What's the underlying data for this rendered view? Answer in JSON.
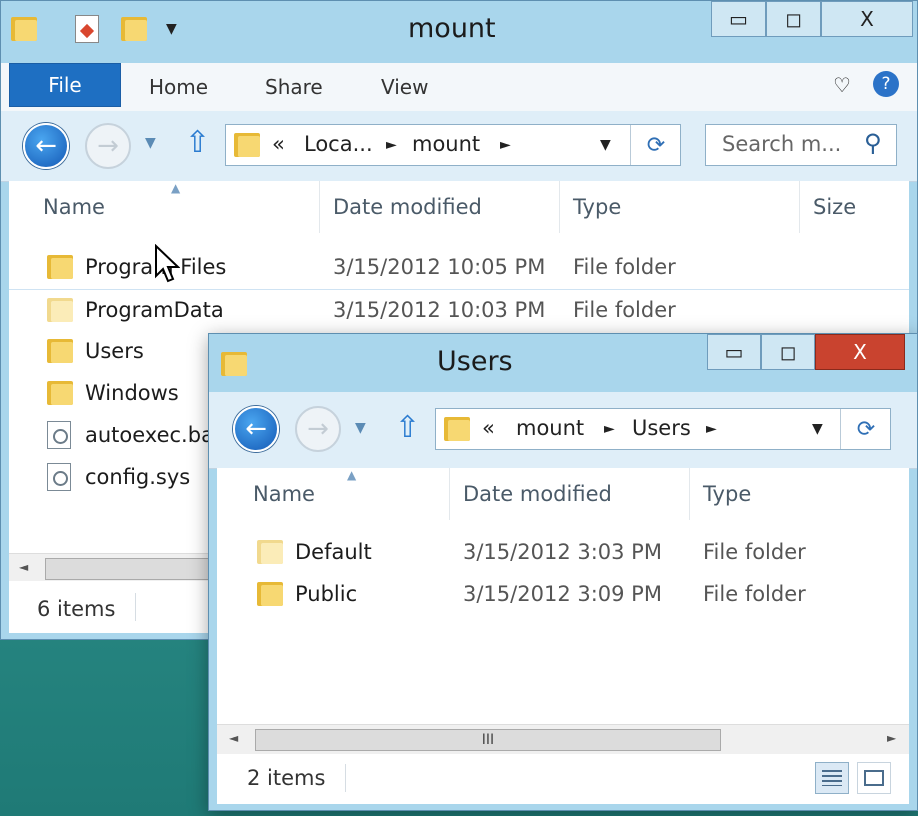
{
  "back_window": {
    "title": "mount",
    "ribbon": {
      "file": "File",
      "tabs": [
        "Home",
        "Share",
        "View"
      ]
    },
    "address": {
      "crumbs": [
        "«",
        "Loca...",
        "►",
        "mount",
        "►"
      ]
    },
    "search": {
      "placeholder": "Search m..."
    },
    "columns": [
      "Name",
      "Date modified",
      "Type",
      "Size"
    ],
    "rows": [
      {
        "name": "Program Files",
        "date": "3/15/2012 10:05 PM",
        "type": "File folder",
        "icon": "folder-icon"
      },
      {
        "name": "ProgramData",
        "date": "3/15/2012 10:03 PM",
        "type": "File folder",
        "icon": "folder-icon"
      },
      {
        "name": "Users",
        "date": "",
        "type": "",
        "icon": "folder-icon"
      },
      {
        "name": "Windows",
        "date": "",
        "type": "",
        "icon": "folder-icon"
      },
      {
        "name": "autoexec.ba",
        "date": "",
        "type": "",
        "icon": "system-file-icon"
      },
      {
        "name": "config.sys",
        "date": "",
        "type": "",
        "icon": "system-file-icon"
      }
    ],
    "status": "6 items"
  },
  "front_window": {
    "title": "Users",
    "address": {
      "crumbs": [
        "«",
        "mount",
        "►",
        "Users",
        "►"
      ]
    },
    "columns": [
      "Name",
      "Date modified",
      "Type"
    ],
    "rows": [
      {
        "name": "Default",
        "date": "3/15/2012 3:03 PM",
        "type": "File folder",
        "icon": "folder-icon"
      },
      {
        "name": "Public",
        "date": "3/15/2012 3:09 PM",
        "type": "File folder",
        "icon": "folder-icon"
      }
    ],
    "scroll_thumb": "III",
    "status": "2 items"
  },
  "icons": {
    "minimize": "▭",
    "maximize": "◻",
    "close": "X",
    "back": "←",
    "forward": "→",
    "dropdown": "▼",
    "up": "⇧",
    "refresh": "⟳",
    "search": "⚲",
    "help": "?",
    "heart": "♡",
    "scroll_left": "◄",
    "scroll_right": "►"
  },
  "colors": {
    "accent": "#1e6fc2",
    "close": "#c9432f",
    "chrome": "#a9d6ec"
  }
}
